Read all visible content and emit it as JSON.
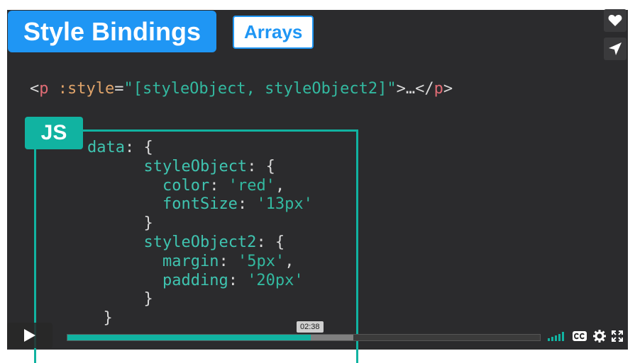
{
  "slide": {
    "title": "Style Bindings",
    "subtitle": "Arrays",
    "template_line": {
      "lt": "<",
      "tag_open": "p",
      "attr": " :style",
      "eq": "=",
      "value": "\"[styleObject, styleObject2]\"",
      "gt_ellipsis": ">…</",
      "tag_close": "p",
      "gt": ">"
    },
    "js_label": "JS",
    "code_lines": [
      {
        "indent": "",
        "key": "data",
        "rest": ": {"
      },
      {
        "indent": "      ",
        "key": "styleObject",
        "rest": ": {"
      },
      {
        "indent": "        ",
        "key": "color",
        "rest": ": ",
        "val": "'red'",
        "tail": ","
      },
      {
        "indent": "        ",
        "key": "fontSize",
        "rest": ": ",
        "val": "'13px'",
        "tail": ""
      },
      {
        "indent": "      ",
        "key": "",
        "rest": "}"
      },
      {
        "indent": "      ",
        "key": "styleObject2",
        "rest": ": {"
      },
      {
        "indent": "        ",
        "key": "margin",
        "rest": ": ",
        "val": "'5px'",
        "tail": ","
      },
      {
        "indent": "        ",
        "key": "padding",
        "rest": ": ",
        "val": "'20px'",
        "tail": ""
      },
      {
        "indent": "      ",
        "key": "",
        "rest": "}"
      },
      {
        "indent": "  ",
        "key": "",
        "rest": "}"
      }
    ]
  },
  "player": {
    "time_tooltip": "02:38",
    "progress_fraction": 0.515,
    "buffer_fraction": 0.605,
    "colors": {
      "accent": "#11b3a1",
      "title_blue": "#1f96f4"
    },
    "icons": [
      "heart-icon",
      "send-icon",
      "play-icon",
      "volume-bars-icon",
      "cc-icon",
      "settings-icon",
      "fullscreen-icon"
    ]
  }
}
